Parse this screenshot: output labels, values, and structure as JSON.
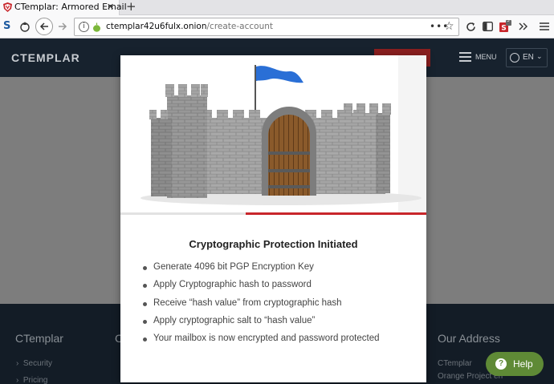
{
  "browser": {
    "tab_title": "CTemplar: Armored Email",
    "new_tab": "+",
    "close_tab": "✕",
    "toolbar_left_letter": "S",
    "url_host": "ctemplar42u6fulx.onion",
    "url_path": "/create-account",
    "url_actions": "•••",
    "addon_badge": "3"
  },
  "header": {
    "logo": "CTEMPLAR",
    "menu_label": "MENU",
    "language": "EN"
  },
  "modal": {
    "title": "Cryptographic Protection Initiated",
    "progress_fraction": 0.59,
    "steps": [
      "Generate 4096 bit PGP Encryption Key",
      "Apply Cryptographic hash to password",
      "Receive “hash value” from cryptographic hash",
      "Apply cryptographic salt to “hash value”",
      "Your mailbox is now encrypted and password protected"
    ]
  },
  "footer": {
    "col1_title": "CTemplar",
    "col1_links": [
      "Security",
      "Pricing"
    ],
    "col2_title_partial": "C",
    "address_title": "Our Address",
    "address_lines": [
      "CTemplar",
      "Orange Project en"
    ]
  },
  "help": {
    "label": "Help"
  },
  "colors": {
    "header_bg": "#17222e",
    "footer_bg": "#131c26",
    "progress": "#c8262b",
    "help_bg": "#5f8a36",
    "overlay": "#7d7d7d"
  }
}
